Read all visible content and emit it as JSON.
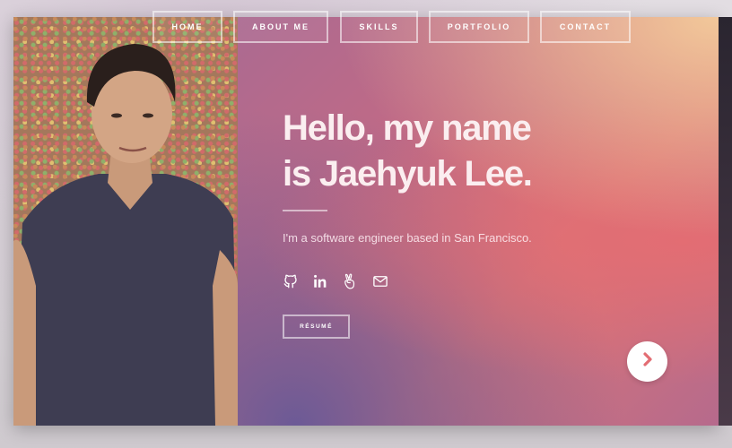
{
  "nav": {
    "items": [
      {
        "label": "HOME"
      },
      {
        "label": "ABOUT ME"
      },
      {
        "label": "SKILLS"
      },
      {
        "label": "PORTFOLIO"
      },
      {
        "label": "CONTACT"
      }
    ]
  },
  "hero": {
    "headline_line1": "Hello, my name",
    "headline_line2": "is Jaehyuk Lee.",
    "subtitle": "I'm a software engineer based in San Francisco.",
    "resume_label": "RÉSUMÉ"
  },
  "socials": [
    {
      "icon": "github-icon"
    },
    {
      "icon": "linkedin-icon"
    },
    {
      "icon": "angellist-icon"
    },
    {
      "icon": "email-icon"
    }
  ],
  "colors": {
    "accent": "#e36d73",
    "gradient_top": "#f2c89a",
    "gradient_bottom": "#6c5a96"
  }
}
